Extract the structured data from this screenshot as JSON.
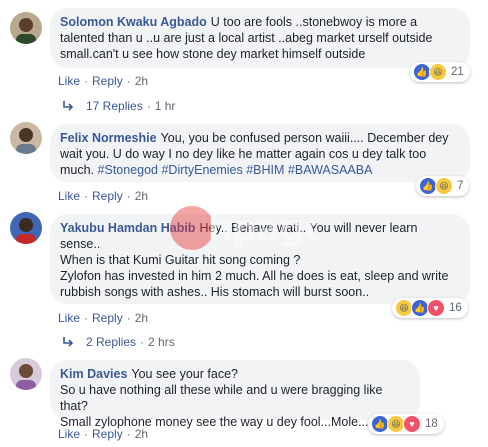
{
  "comments": [
    {
      "author": "Solomon Kwaku Agbado",
      "text": "U too are fools ..stonebwoy is more a talented than u ..u are just a local artist ..abeg market urself outside small.can't u see how stone dey market himself outside",
      "like": "Like",
      "reply": "Reply",
      "time": "2h",
      "reaction_count": "21",
      "replies_label": "17 Replies",
      "replies_time": "1 hr"
    },
    {
      "author": "Felix Normeshie",
      "text": "You, you be confused person waiii.... December dey wait you. U do way I no dey like he matter again cos u dey talk too much.",
      "hashtags": "#Stonegod #DirtyEnemies #BHIM #BAWASAABA",
      "like": "Like",
      "reply": "Reply",
      "time": "2h",
      "reaction_count": "7"
    },
    {
      "author": "Yakubu Hamdan Habib",
      "line1": "Hey.. Behave wati.. You will never learn sense..",
      "line2": "When is that Kumi Guitar hit song coming ?",
      "line3": "Zylofon has invested in him 2 much. All he does is eat, sleep and write rubbish songs with ashes.. His stomach will burst soon..",
      "like": "Like",
      "reply": "Reply",
      "time": "2h",
      "reaction_count": "16",
      "replies_label": "2 Replies",
      "replies_time": "2 hrs"
    },
    {
      "author": "Kim Davies",
      "line1": "You see your face?",
      "line2": "So u have nothing all these while and u were bragging like that?",
      "line3": "Small zylophone money see the way u dey fool...Mole...",
      "like": "Like",
      "reply": "Reply",
      "time": "2h",
      "reaction_count": "18"
    }
  ],
  "separator": "·",
  "watermark": "hpage",
  "colors": {
    "link": "#385898",
    "bubble": "#f2f3f5",
    "meta": "#606770",
    "like_reaction": "#3b65d6",
    "haha_reaction": "#f7c93e",
    "love_reaction": "#f25268"
  }
}
